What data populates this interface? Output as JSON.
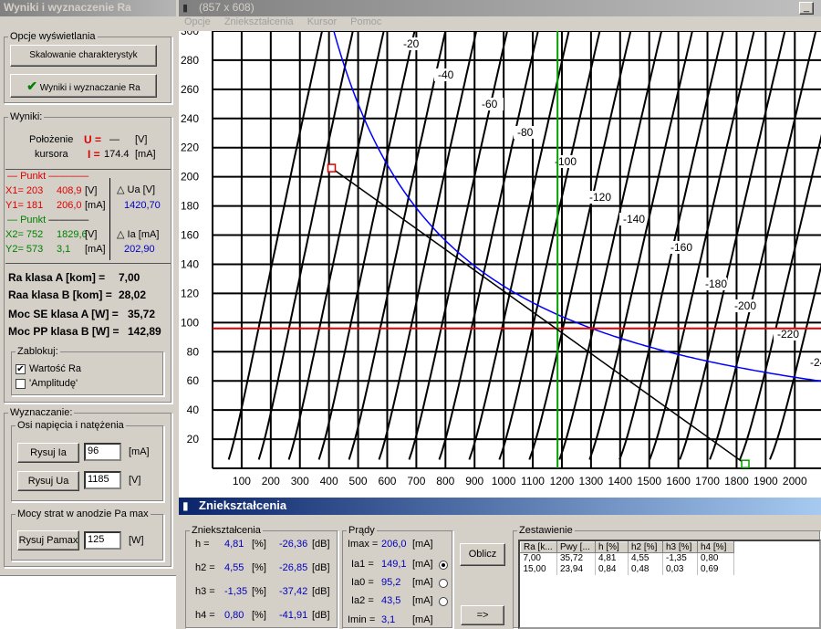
{
  "left_panel": {
    "title": "Wyniki i wyznaczenie Ra",
    "display_group": "Opcje wyświetlania",
    "btn_scale": "Skalowanie charakterystyk",
    "btn_results": "Wyniki i wyznaczanie Ra",
    "results_group": "Wyniki:",
    "position_label": "Położenie",
    "cursor_label": "kursora",
    "u_label": "U =",
    "u_value": "—",
    "u_unit": "[V]",
    "i_label": "I =",
    "i_value": "174.4",
    "i_unit": "[mA]",
    "point1_label": "Punkt",
    "x1": "X1= 203",
    "x1_val": "408,9",
    "x1_unit": "[V]",
    "y1": "Y1= 181",
    "y1_val": "206,0",
    "y1_unit": "[mA]",
    "delta_ua_label": "Ua [V]",
    "delta_ua_value": "1420,70",
    "point2_label": "Punkt",
    "x2": "X2= 752",
    "x2_val": "1829,6",
    "x2_unit": "[V]",
    "y2": "Y2= 573",
    "y2_val": "3,1",
    "y2_unit": "[mA]",
    "delta_ia_label": "Ia [mA]",
    "delta_ia_value": "202,90",
    "ra_a_label": "Ra klasa A [kom] =",
    "ra_a_value": "7,00",
    "raa_b_label": "Raa klasa B [kom] =",
    "raa_b_value": "28,02",
    "moc_se_label": "Moc SE klasa A [W] =",
    "moc_se_value": "35,72",
    "moc_pp_label": "Moc PP klasa B [W] =",
    "moc_pp_value": "142,89",
    "lock_group": "Zablokuj:",
    "lock_ra": "Wartość Ra",
    "lock_amp": "'Amplitudę'",
    "determine_group": "Wyznaczanie:",
    "axes_group": "Osi napięcia i natężenia",
    "btn_ia": "Rysuj Ia",
    "ia_value": "96",
    "ia_unit": "[mA]",
    "btn_ua": "Rysuj Ua",
    "ua_value": "1185",
    "ua_unit": "[V]",
    "pmax_group": "Mocy strat w anodzie  Pa max",
    "btn_pmax": "Rysuj Pamax",
    "pmax_value": "125",
    "pmax_unit": "[W]"
  },
  "chart_window": {
    "title": "(857 x 608)",
    "menu": [
      "Opcje",
      "Zniekształcenia",
      "Kursor",
      "Pomoc"
    ]
  },
  "chart_data": {
    "type": "line",
    "x_ticks": [
      "100",
      "200",
      "300",
      "400",
      "500",
      "600",
      "700",
      "800",
      "900",
      "1000",
      "1100",
      "1200",
      "1300",
      "1400",
      "1500",
      "1600",
      "1700",
      "1800",
      "1900",
      "2000"
    ],
    "y_ticks": [
      "20",
      "40",
      "60",
      "80",
      "100",
      "120",
      "140",
      "160",
      "180",
      "200",
      "220",
      "240",
      "260",
      "280",
      "300"
    ],
    "xlim": [
      0,
      2090
    ],
    "ylim": [
      0,
      300
    ],
    "grid": true,
    "curve_labels": [
      "-20",
      "-40",
      "-60",
      "-80",
      "-100",
      "-120",
      "-140",
      "-160",
      "-180",
      "-200",
      "-220",
      "-24"
    ],
    "load_line": [
      [
        409,
        206
      ],
      [
        1830,
        3
      ]
    ],
    "hline_y": 96,
    "vline_x": 1185,
    "power_curve_watts": 125,
    "colors": {
      "load_line": "#000000",
      "hline": "#e00000",
      "vline": "#00a000",
      "power_curve": "#0000ff"
    }
  },
  "distortion_window": {
    "title": "Zniekształcenia",
    "dist_group": "Zniekształcenia",
    "rows": [
      {
        "label": "h =",
        "pct": "4,81",
        "unit": "[%]",
        "db": "-26,36",
        "db_unit": "[dB]"
      },
      {
        "label": "h2 =",
        "pct": "4,55",
        "unit": "[%]",
        "db": "-26,85",
        "db_unit": "[dB]"
      },
      {
        "label": "h3 =",
        "pct": "-1,35",
        "unit": "[%]",
        "db": "-37,42",
        "db_unit": "[dB]"
      },
      {
        "label": "h4 =",
        "pct": "0,80",
        "unit": "[%]",
        "db": "-41,91",
        "db_unit": "[dB]"
      }
    ],
    "currents_group": "Prądy",
    "imax_label": "Imax =",
    "imax_val": "206,0",
    "imax_unit": "[mA]",
    "ia1_label": "Ia1 =",
    "ia1_val": "149,1",
    "ia1_unit": "[mA]",
    "ia0_label": "Ia0 =",
    "ia0_val": "95,2",
    "ia0_unit": "[mA]",
    "ia2_label": "Ia2 =",
    "ia2_val": "43,5",
    "ia2_unit": "[mA]",
    "imin_label": "Imin =",
    "imin_val": "3,1",
    "imin_unit": "[mA]",
    "btn_calc": "Oblicz",
    "btn_arrow": "=>",
    "summary_group": "Zestawienie",
    "summary_headers": [
      "Ra [k...",
      "Pwy [...",
      "h [%]",
      "h2 [%]",
      "h3 [%]",
      "h4 [%]"
    ],
    "summary_rows": [
      [
        "7,00",
        "35,72",
        "4,81",
        "4,55",
        "-1,35",
        "0,80"
      ],
      [
        "15,00",
        "23,94",
        "0,84",
        "0,48",
        "0,03",
        "0,69"
      ]
    ]
  }
}
